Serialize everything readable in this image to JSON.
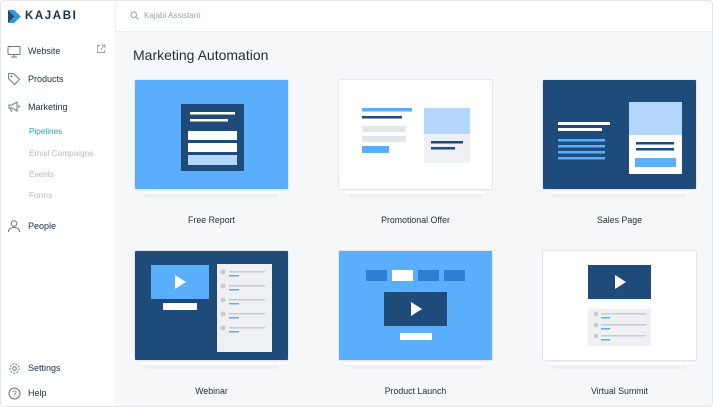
{
  "app": {
    "logo_text": "KAJABI"
  },
  "topbar": {
    "search_placeholder": "Kajabi Assistant"
  },
  "sidebar": {
    "items": [
      {
        "label": "Website"
      },
      {
        "label": "Products"
      },
      {
        "label": "Marketing"
      },
      {
        "label": "People"
      },
      {
        "label": "Settings"
      },
      {
        "label": "Help"
      }
    ],
    "marketing_sub": [
      {
        "label": "Pipelines",
        "active": true
      },
      {
        "label": "Email Campaigns",
        "active": false
      },
      {
        "label": "Events",
        "active": false
      },
      {
        "label": "Forms",
        "active": false
      }
    ]
  },
  "main": {
    "title": "Marketing Automation",
    "cards": [
      {
        "label": "Free Report"
      },
      {
        "label": "Promotional Offer"
      },
      {
        "label": "Sales Page"
      },
      {
        "label": "Webinar"
      },
      {
        "label": "Product Launch"
      },
      {
        "label": "Virtual Summit"
      }
    ]
  },
  "colors": {
    "accent": "#2e9bd6",
    "navy": "#1f4b7a",
    "sky": "#5aaefc",
    "light_blue": "#b3d7fb",
    "text": "#1f2d3d",
    "muted": "#b2bac4"
  }
}
